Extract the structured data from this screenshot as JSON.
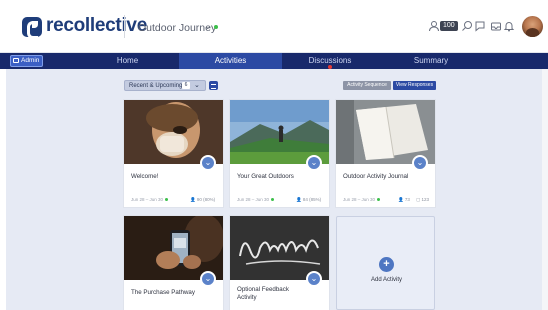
{
  "brand": {
    "name": "recollective"
  },
  "project": {
    "name": "Outdoor Journey"
  },
  "header": {
    "points": "100"
  },
  "nav": {
    "admin_label": "Admin",
    "tabs": [
      {
        "label": "Home"
      },
      {
        "label": "Activities"
      },
      {
        "label": "Discussions"
      },
      {
        "label": "Summary"
      }
    ]
  },
  "toolbar": {
    "filter_label": "Recent & Upcoming",
    "filter_count": "6",
    "sequence_label": "Activity Sequence",
    "responses_label": "View Responses"
  },
  "cards": [
    {
      "title": "Welcome!",
      "dates": "Jun 28 – Jun 30",
      "participants": "90 (80%)",
      "comments": ""
    },
    {
      "title": "Your Great Outdoors",
      "dates": "Jun 28 – Jun 30",
      "participants": "84 (85%)",
      "comments": ""
    },
    {
      "title": "Outdoor Activity Journal",
      "dates": "Jun 28 – Jun 30",
      "participants": "73",
      "comments": "123"
    },
    {
      "title": "The Purchase Pathway",
      "dates": "",
      "participants": "",
      "comments": ""
    },
    {
      "title": "Optional Feedback Activity",
      "dates": "",
      "participants": "",
      "comments": ""
    }
  ],
  "add_card": {
    "label": "Add Activity"
  },
  "colors": {
    "brand": "#1f3d7a",
    "navbar": "#18296b",
    "active_tab": "#2c4aa3",
    "accent": "#5b82c9"
  },
  "icons": [
    "user-icon",
    "search-icon",
    "chat-icon",
    "inbox-icon",
    "bell-icon",
    "chevron-down-icon",
    "plus-icon"
  ]
}
